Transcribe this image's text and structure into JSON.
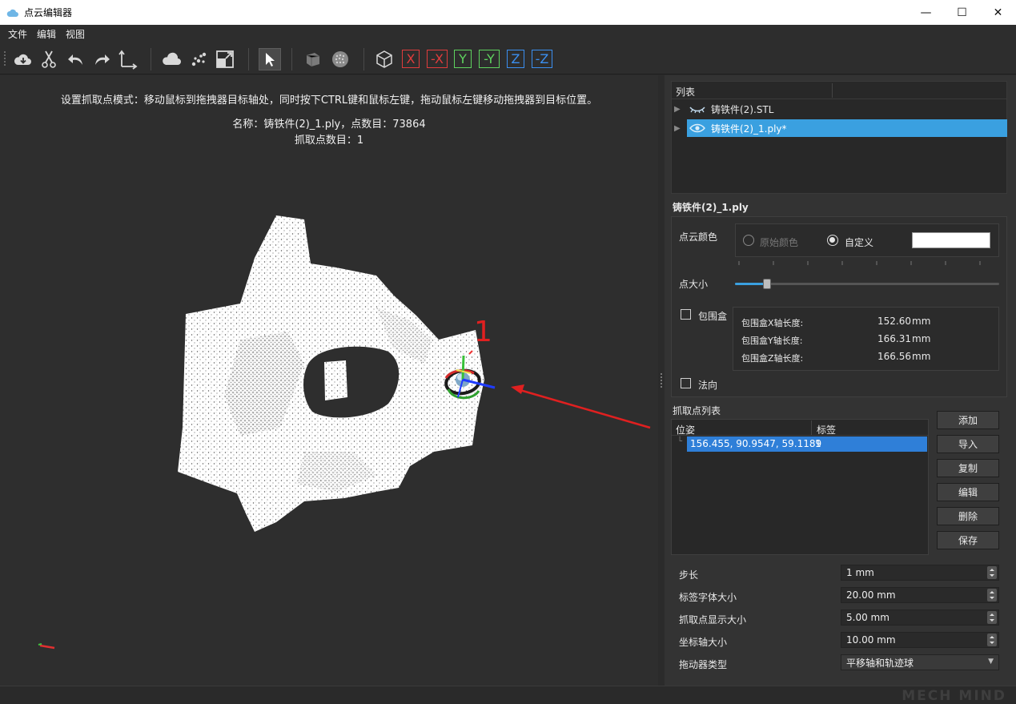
{
  "window": {
    "title": "点云编辑器",
    "minimize": "—",
    "maximize": "☐",
    "close": "✕"
  },
  "menu": [
    "文件",
    "编辑",
    "视图"
  ],
  "toolbar": {
    "icons": [
      "cloud-download-icon",
      "scissors-icon",
      "undo-icon",
      "redo-icon",
      "axes-icon",
      "cloud-icon",
      "points-icon",
      "fit-view-icon",
      "select-pointer-icon",
      "mesh-solid-icon",
      "sphere-points-icon",
      "cube-view-icon"
    ],
    "axis_buttons": [
      {
        "label": "X",
        "color": "#e03c3c"
      },
      {
        "label": "-X",
        "color": "#e03c3c"
      },
      {
        "label": "Y",
        "color": "#5fd35f"
      },
      {
        "label": "-Y",
        "color": "#5fd35f"
      },
      {
        "label": "Z",
        "color": "#3b8ff0"
      },
      {
        "label": "-Z",
        "color": "#3b8ff0"
      }
    ]
  },
  "viewport": {
    "instruction": "设置抓取点模式：移动鼠标到拖拽器目标轴处，同时按下CTRL键和鼠标左键，拖动鼠标左键移动拖拽器到目标位置。",
    "info_line": "名称：铸铁件(2)_1.ply，点数目：73864",
    "grasp_count": "抓取点数目：1",
    "annotation_label": "1"
  },
  "list_panel": {
    "header": "列表",
    "items": [
      {
        "label": "铸铁件(2).STL",
        "visible": false,
        "selected": false
      },
      {
        "label": "铸铁件(2)_1.ply*",
        "visible": true,
        "selected": true
      }
    ]
  },
  "properties": {
    "object_name": "铸铁件(2)_1.ply",
    "color_label": "点云颜色",
    "original_color": "原始颜色",
    "custom_color": "自定义",
    "custom_swatch": "#ffffff",
    "point_size_label": "点大小",
    "point_size_fraction": 0.12,
    "bbox_label": "包围盒",
    "bbox": [
      {
        "label": "包围盒X轴长度:",
        "value": "152.60",
        "unit": "mm"
      },
      {
        "label": "包围盒Y轴长度:",
        "value": "166.31",
        "unit": "mm"
      },
      {
        "label": "包围盒Z轴长度:",
        "value": "166.56",
        "unit": "mm"
      }
    ],
    "normal_label": "法向"
  },
  "grasp_list": {
    "title": "抓取点列表",
    "columns": [
      "位姿",
      "标签"
    ],
    "rows": [
      {
        "pose": "156.455, 90.9547, 59.1189",
        "tag": "1"
      }
    ],
    "buttons": [
      "添加",
      "导入",
      "复制",
      "编辑",
      "删除",
      "保存"
    ]
  },
  "settings": [
    {
      "label": "步长",
      "value": "1 mm"
    },
    {
      "label": "标签字体大小",
      "value": "20.00 mm"
    },
    {
      "label": "抓取点显示大小",
      "value": "5.00 mm"
    },
    {
      "label": "坐标轴大小",
      "value": "10.00 mm"
    }
  ],
  "dragger_type": {
    "label": "拖动器类型",
    "value": "平移轴和轨迹球"
  },
  "watermark": "MECH MIND"
}
